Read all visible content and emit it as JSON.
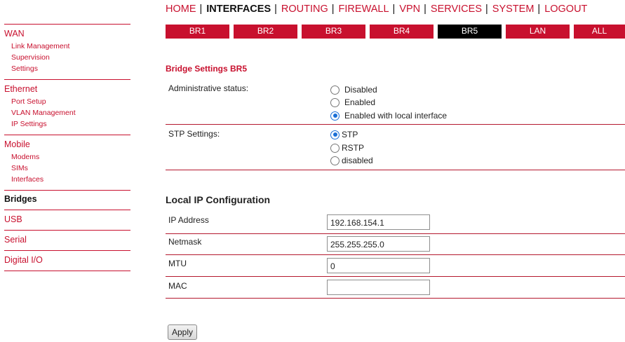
{
  "topnav": {
    "items": [
      {
        "label": "HOME"
      },
      {
        "label": "INTERFACES"
      },
      {
        "label": "ROUTING"
      },
      {
        "label": "FIREWALL"
      },
      {
        "label": "VPN"
      },
      {
        "label": "SERVICES"
      },
      {
        "label": "SYSTEM"
      },
      {
        "label": "LOGOUT"
      }
    ],
    "separator": "|",
    "active": "INTERFACES"
  },
  "tabs": {
    "items": [
      {
        "label": "BR1"
      },
      {
        "label": "BR2"
      },
      {
        "label": "BR3"
      },
      {
        "label": "BR4"
      },
      {
        "label": "BR5"
      },
      {
        "label": "LAN"
      },
      {
        "label": "ALL"
      }
    ],
    "active": "BR5"
  },
  "sidebar": {
    "wan": {
      "label": "WAN",
      "items": [
        {
          "label": "Link Management"
        },
        {
          "label": "Supervision"
        },
        {
          "label": "Settings"
        }
      ]
    },
    "ethernet": {
      "label": "Ethernet",
      "items": [
        {
          "label": "Port Setup"
        },
        {
          "label": "VLAN Management"
        },
        {
          "label": "IP Settings"
        }
      ]
    },
    "mobile": {
      "label": "Mobile",
      "items": [
        {
          "label": "Modems"
        },
        {
          "label": "SIMs"
        },
        {
          "label": "Interfaces"
        }
      ]
    },
    "bridges": {
      "label": "Bridges"
    },
    "usb": {
      "label": "USB"
    },
    "serial": {
      "label": "Serial"
    },
    "digital_io": {
      "label": "Digital I/O"
    },
    "active": "Bridges"
  },
  "bridge_settings": {
    "title": "Bridge Settings BR5",
    "admin_status": {
      "label": "Administrative status:",
      "options": [
        {
          "label": "Disabled",
          "checked": false
        },
        {
          "label": "Enabled",
          "checked": false
        },
        {
          "label": "Enabled with local interface",
          "checked": true
        }
      ]
    },
    "stp": {
      "label": "STP Settings:",
      "options": [
        {
          "label": "STP",
          "checked": true
        },
        {
          "label": "RSTP",
          "checked": false
        },
        {
          "label": "disabled",
          "checked": false
        }
      ]
    }
  },
  "local_ip": {
    "title": "Local IP Configuration",
    "ip_address": {
      "label": "IP Address",
      "value": "192.168.154.1"
    },
    "netmask": {
      "label": "Netmask",
      "value": "255.255.255.0"
    },
    "mtu": {
      "label": "MTU",
      "value": "0"
    },
    "mac": {
      "label": "MAC",
      "value": ""
    }
  },
  "apply_label": "Apply",
  "colors": {
    "accent": "#c8102e",
    "active_tab": "#000000",
    "radio_checked": "#1a6fd6"
  }
}
